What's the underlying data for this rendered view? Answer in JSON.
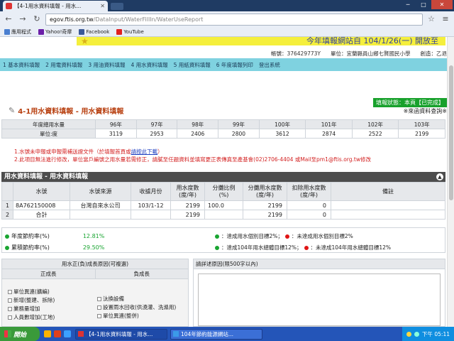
{
  "browser": {
    "tab_title": "【4-1用水資料填報 - 用水...",
    "url_host": "egov.ftis.org.tw",
    "url_path": "/DataInput/WaterFillIn/WaterUseReport",
    "bookmarks": [
      {
        "label": "應用程式",
        "color": "#4a7fd0"
      },
      {
        "label": "Yahoo!奇摩",
        "color": "#6b1fa8"
      },
      {
        "label": "Facebook",
        "color": "#3b5998"
      },
      {
        "label": "YouTube",
        "color": "#e02020"
      }
    ]
  },
  "banner": {
    "text": "今年填報網站自 104/1/26(一) 開放至"
  },
  "account": {
    "account_label": "帳號：",
    "account_value": "376429773Y",
    "unit_label": "單位：",
    "unit_value": "宜蘭縣員山鄉七賢國民小學",
    "creator_label": "創造：",
    "creator_value": "乙退"
  },
  "nav": [
    "1 基本資料填報",
    "2 用電資料填報",
    "3 用油資料填報",
    "4 用水資料填報",
    "5 用紙資料填報",
    "6 年度填報列印",
    "登出系統"
  ],
  "status": {
    "badge": "填報狀態：本頁【已完成】",
    "ref_link": "※來函資料查詢※"
  },
  "section_title": "4-1用水資料填報 - 用水資料填報",
  "baseline": {
    "row_label": "年度總用水量",
    "unit_label": "單位:度",
    "years": [
      "96年",
      "97年",
      "98年",
      "99年",
      "100年",
      "101年",
      "102年",
      "103年"
    ],
    "values": [
      "3119",
      "2953",
      "2406",
      "2800",
      "3612",
      "2874",
      "2522",
      "2199"
    ]
  },
  "notes": {
    "line1_a": "1.水號未申報或申報需補送證文件（於填報首頁或",
    "line1_link": "請按此下載",
    "line1_b": "）",
    "line2": "2.此項目無法進行修改，單位當戶編號之用水量若需修正，請膩至任題資料並填寫更正表傳真至產基會(02)2706-4404 或Mail至pm1@ftis.org.tw修改"
  },
  "panel": {
    "title": "用水資料填報 - 用水資料填報",
    "collapse": "▲"
  },
  "water_table": {
    "headers": [
      "水號",
      "水號來源",
      "收據月份",
      "用水度數\n(度/年)",
      "分攤比例\n(%)",
      "分攤用水度數\n(度/年)",
      "扣除用水度數\n(度/年)",
      "備註"
    ],
    "rows": [
      {
        "idx": "1",
        "meter": "8A762150008",
        "source": "台灣自來水公司",
        "month": "103/1-12",
        "usage": "2199",
        "ratio": "100.0",
        "alloc": "2199",
        "deduct": "0",
        "remark": ""
      },
      {
        "idx": "2",
        "meter": "合計",
        "source": "",
        "month": "",
        "usage": "2199",
        "ratio": "",
        "alloc": "2199",
        "deduct": "0",
        "remark": ""
      }
    ]
  },
  "stats": {
    "annual_label": "年度節約率(%)",
    "annual_value": "12.81%",
    "cumulative_label": "累積節約率(%)",
    "cumulative_value": "29.50%",
    "legend_a_green": "：達成用水個別目標2%；",
    "legend_a_red": "：未達成用水個別目標2%",
    "legend_b_green": "：達成104年用水總體目標12%；",
    "legend_b_red": "：未達成104年用水總體目標12%"
  },
  "reasons": {
    "title": "用水正(負)成長原因(可複選)",
    "positive": "正成長",
    "negative": "負成長",
    "positive_items": [
      "單位異連(擴編)",
      "新增(整建、拆除)",
      "業務量增加",
      "人員數增加(工地)"
    ],
    "negative_items": [
      "汰換設備",
      "設置雨水回收(供澆灌、洗滌用)",
      "單位異連(整併)"
    ]
  },
  "desc": {
    "title": "請詳述原因(限500字以內)"
  },
  "taskbar": {
    "start": "開始",
    "task1": "【4-1用水資料填報 - 用水...",
    "task2": "104年節約能源網站...",
    "clock": "下午 05:11"
  }
}
